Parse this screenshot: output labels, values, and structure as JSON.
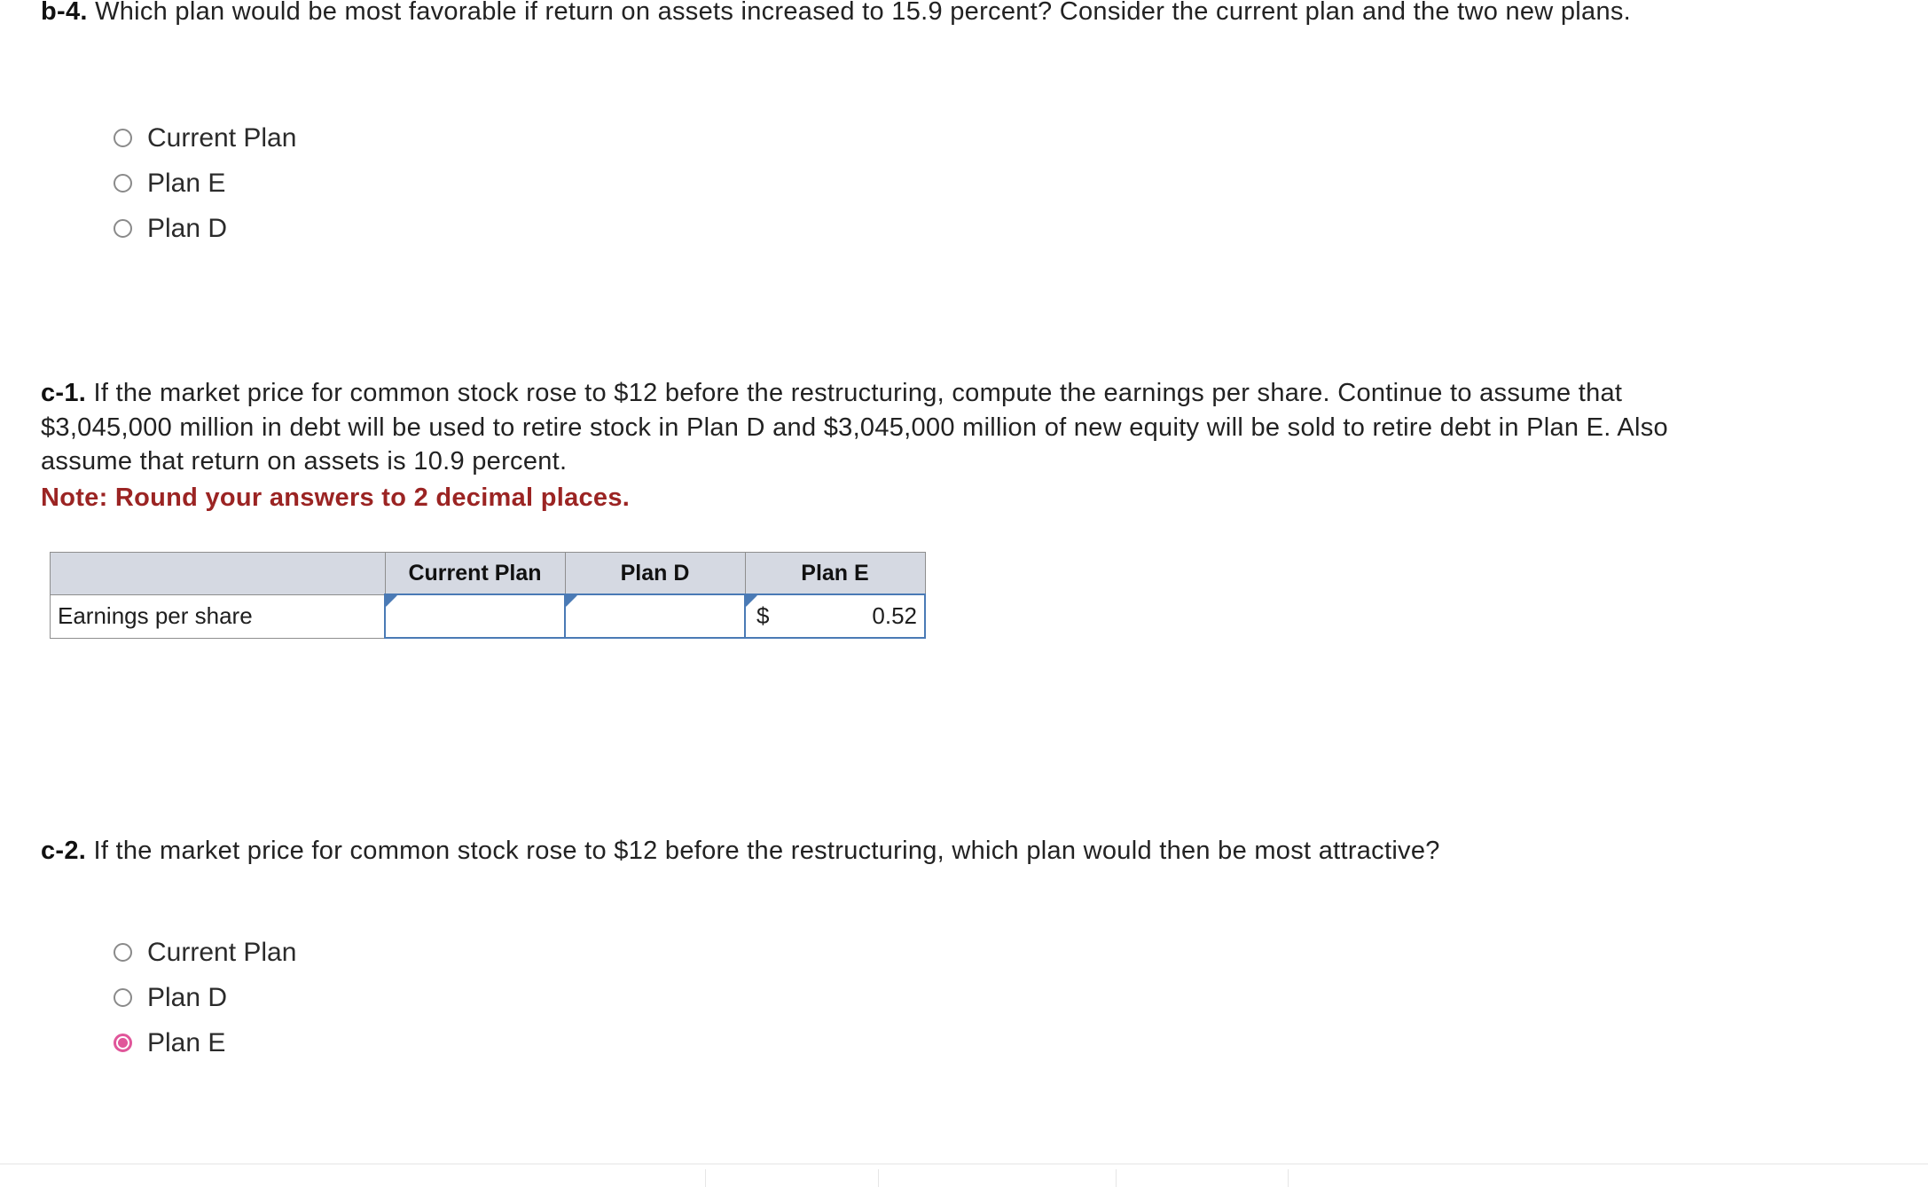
{
  "questions": {
    "b4": {
      "label": "b-4.",
      "text": " Which plan would be most favorable if return on assets increased to 15.9 percent? Consider the current plan and the two new plans."
    },
    "c1": {
      "label": "c-1.",
      "text": " If the market price for common stock rose to $12 before the restructuring, compute the earnings per share. Continue to assume that $3,045,000 million in debt will be used to retire stock in Plan D and $3,045,000 million of new equity will be sold to retire debt in Plan E. Also assume that return on assets is 10.9 percent.",
      "note": "Note: Round your answers to 2 decimal places."
    },
    "c2": {
      "label": "c-2.",
      "text": " If the market price for common stock rose to $12 before the restructuring, which plan would then be most attractive?"
    }
  },
  "radio_group_b4": {
    "options": [
      {
        "label": "Current Plan",
        "selected": false
      },
      {
        "label": "Plan E",
        "selected": false
      },
      {
        "label": "Plan D",
        "selected": false
      }
    ]
  },
  "radio_group_c2": {
    "options": [
      {
        "label": "Current Plan",
        "selected": false
      },
      {
        "label": "Plan D",
        "selected": false
      },
      {
        "label": "Plan E",
        "selected": true
      }
    ]
  },
  "answer_table": {
    "headers": [
      "",
      "Current Plan",
      "Plan D",
      "Plan E"
    ],
    "rows": [
      {
        "label": "Earnings per share",
        "cells": [
          {
            "currency": "",
            "value": ""
          },
          {
            "currency": "",
            "value": ""
          },
          {
            "currency": "$",
            "value": "0.52"
          }
        ]
      }
    ]
  },
  "colors": {
    "note_red": "#9b2423",
    "radio_selected": "#e0569a",
    "table_header_bg": "#d5d9e2",
    "input_border": "#4a7ab5"
  }
}
